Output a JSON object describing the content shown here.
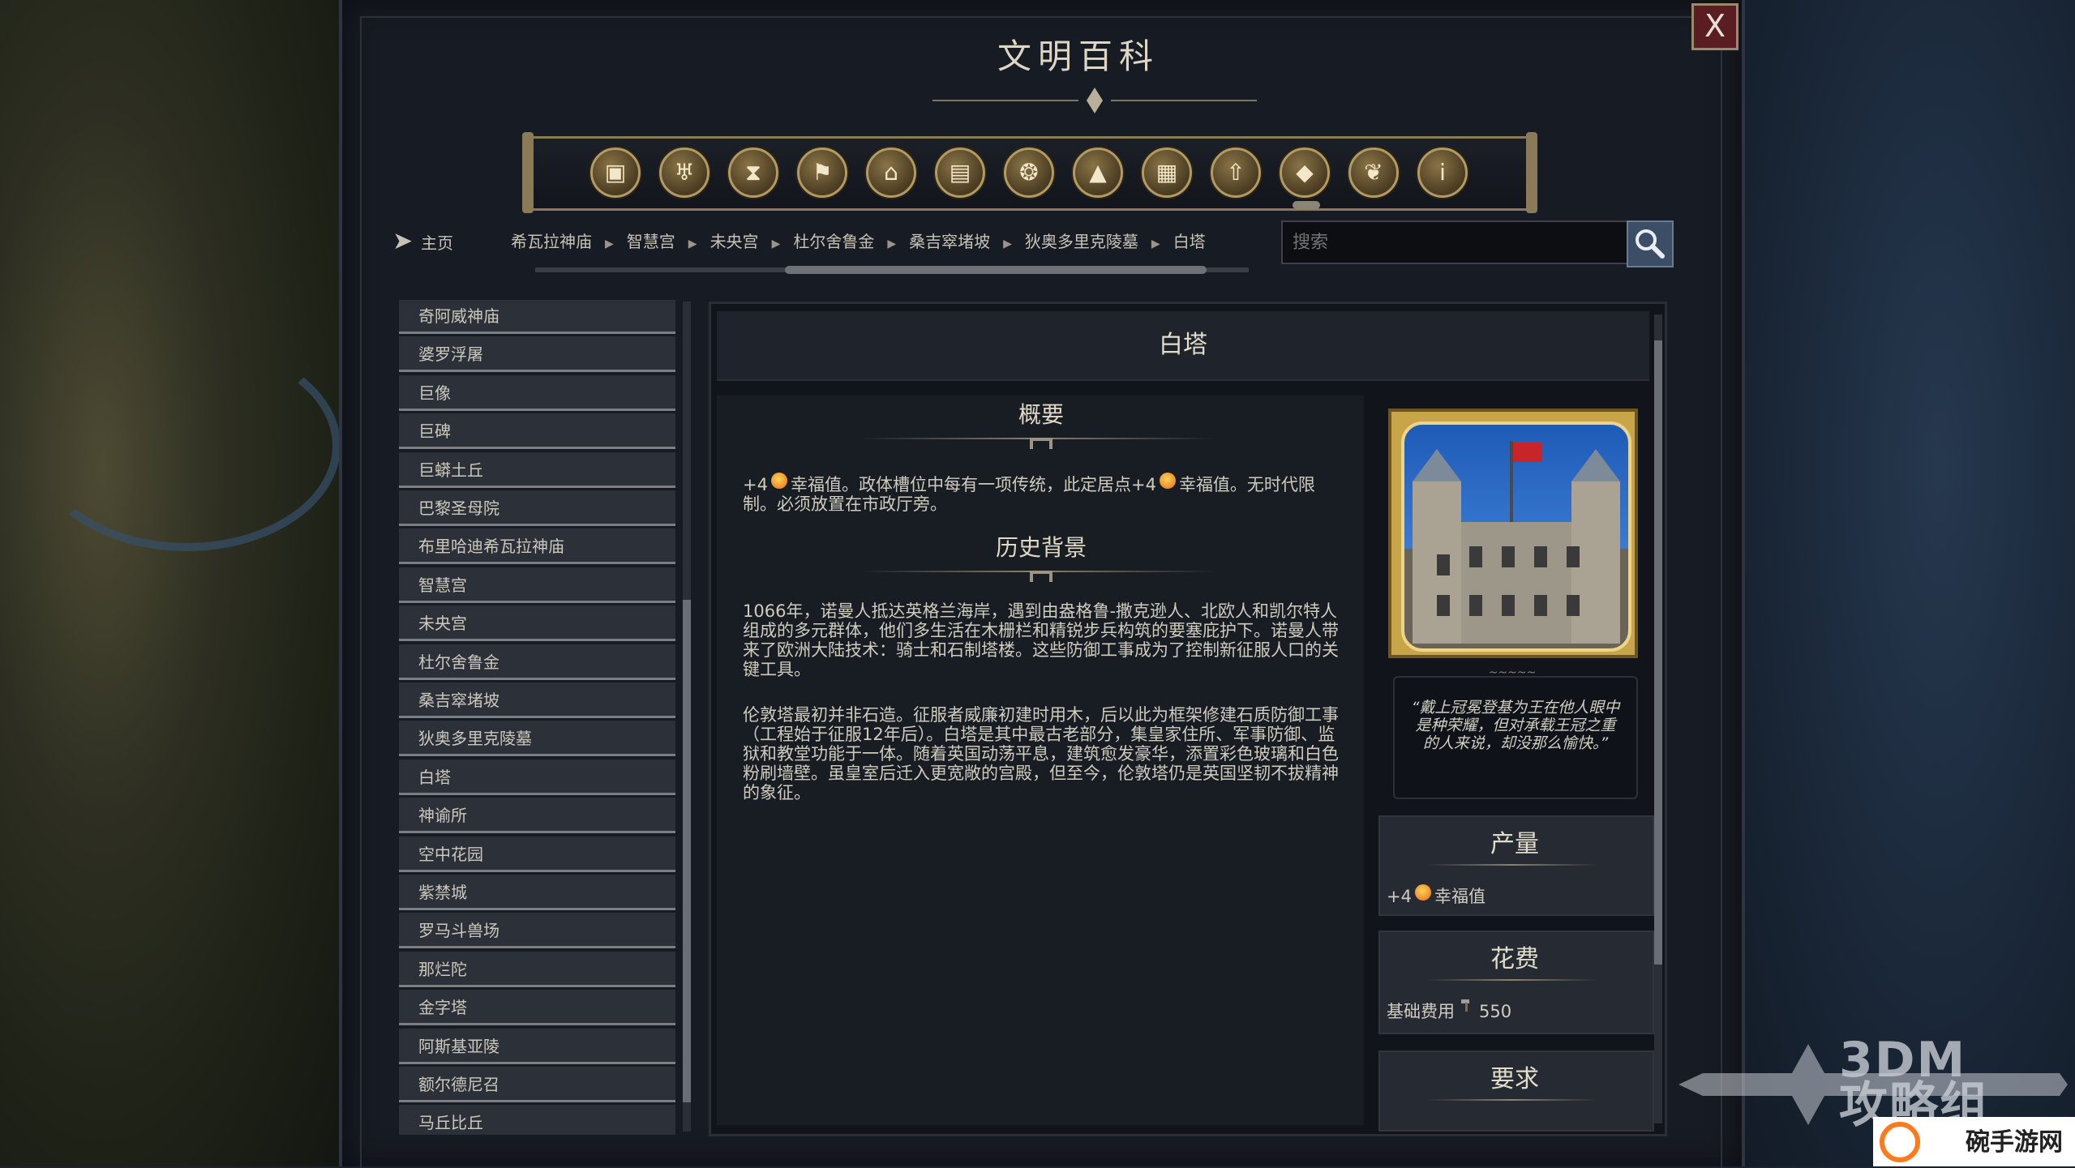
{
  "window": {
    "title": "文明百科",
    "close_label": "X"
  },
  "categories": [
    {
      "icon": "boxes-icon",
      "glyph": "▣"
    },
    {
      "icon": "goblet-icon",
      "glyph": "♅"
    },
    {
      "icon": "hourglass-icon",
      "glyph": "⧗"
    },
    {
      "icon": "flag-icon",
      "glyph": "⚑"
    },
    {
      "icon": "temple-icon",
      "glyph": "⌂"
    },
    {
      "icon": "book-icon",
      "glyph": "▤"
    },
    {
      "icon": "medal-icon",
      "glyph": "❂"
    },
    {
      "icon": "mountain-icon",
      "glyph": "▲"
    },
    {
      "icon": "building-icon",
      "glyph": "▦"
    },
    {
      "icon": "arrow-up-icon",
      "glyph": "⇧"
    },
    {
      "icon": "pyramid-icon",
      "glyph": "◆"
    },
    {
      "icon": "dove-icon",
      "glyph": "❦"
    },
    {
      "icon": "info-icon",
      "glyph": "ⅰ"
    }
  ],
  "nav": {
    "home_label": "主页",
    "breadcrumbs": [
      "希瓦拉神庙",
      "智慧宫",
      "未央宫",
      "杜尔舍鲁金",
      "桑吉窣堵坡",
      "狄奥多里克陵墓",
      "白塔"
    ]
  },
  "search": {
    "placeholder": "搜索"
  },
  "list": {
    "items": [
      "奇阿威神庙",
      "婆罗浮屠",
      "巨像",
      "巨碑",
      "巨蟒土丘",
      "巴黎圣母院",
      "布里哈迪希瓦拉神庙",
      "智慧宫",
      "未央宫",
      "杜尔舍鲁金",
      "桑吉窣堵坡",
      "狄奥多里克陵墓",
      "白塔",
      "神谕所",
      "空中花园",
      "紫禁城",
      "罗马斗兽场",
      "那烂陀",
      "金字塔",
      "阿斯基亚陵",
      "额尔德尼召",
      "马丘比丘"
    ]
  },
  "detail": {
    "title": "白塔",
    "overview_title": "概要",
    "overview_pre": "+4",
    "overview_mid": "幸福值。政体槽位中每有一项传统，此定居点+4",
    "overview_post": "幸福值。无时代限制。必须放置在市政厅旁。",
    "history_title": "历史背景",
    "history_p1": "1066年，诺曼人抵达英格兰海岸，遇到由盎格鲁-撒克逊人、北欧人和凯尔特人组成的多元群体，他们多生活在木栅栏和精锐步兵构筑的要塞庇护下。诺曼人带来了欧洲大陆技术：骑士和石制塔楼。这些防御工事成为了控制新征服人口的关键工具。",
    "history_p2": "伦敦塔最初并非石造。征服者威廉初建时用木，后以此为框架修建石质防御工事（工程始于征服12年后）。白塔是其中最古老部分，集皇家住所、军事防御、监狱和教堂功能于一体。随着英国动荡平息，建筑愈发豪华，添置彩色玻璃和白色粉刷墙壁。虽皇室后迁入更宽敞的宫殿，但至今，伦敦塔仍是英国坚韧不拔精神的象征。",
    "quote": "“戴上冠冕登基为王在他人眼中是种荣耀，但对承载王冠之重的人来说，却没那么愉快。”",
    "production_title": "产量",
    "production_amount": "+4",
    "production_label": "幸福值",
    "cost_title": "花费",
    "cost_label": "基础费用",
    "cost_value": "550",
    "requirements_title": "要求"
  },
  "watermarks": {
    "left_text": "3DM\n攻略组",
    "right_text": "碗手游网"
  }
}
